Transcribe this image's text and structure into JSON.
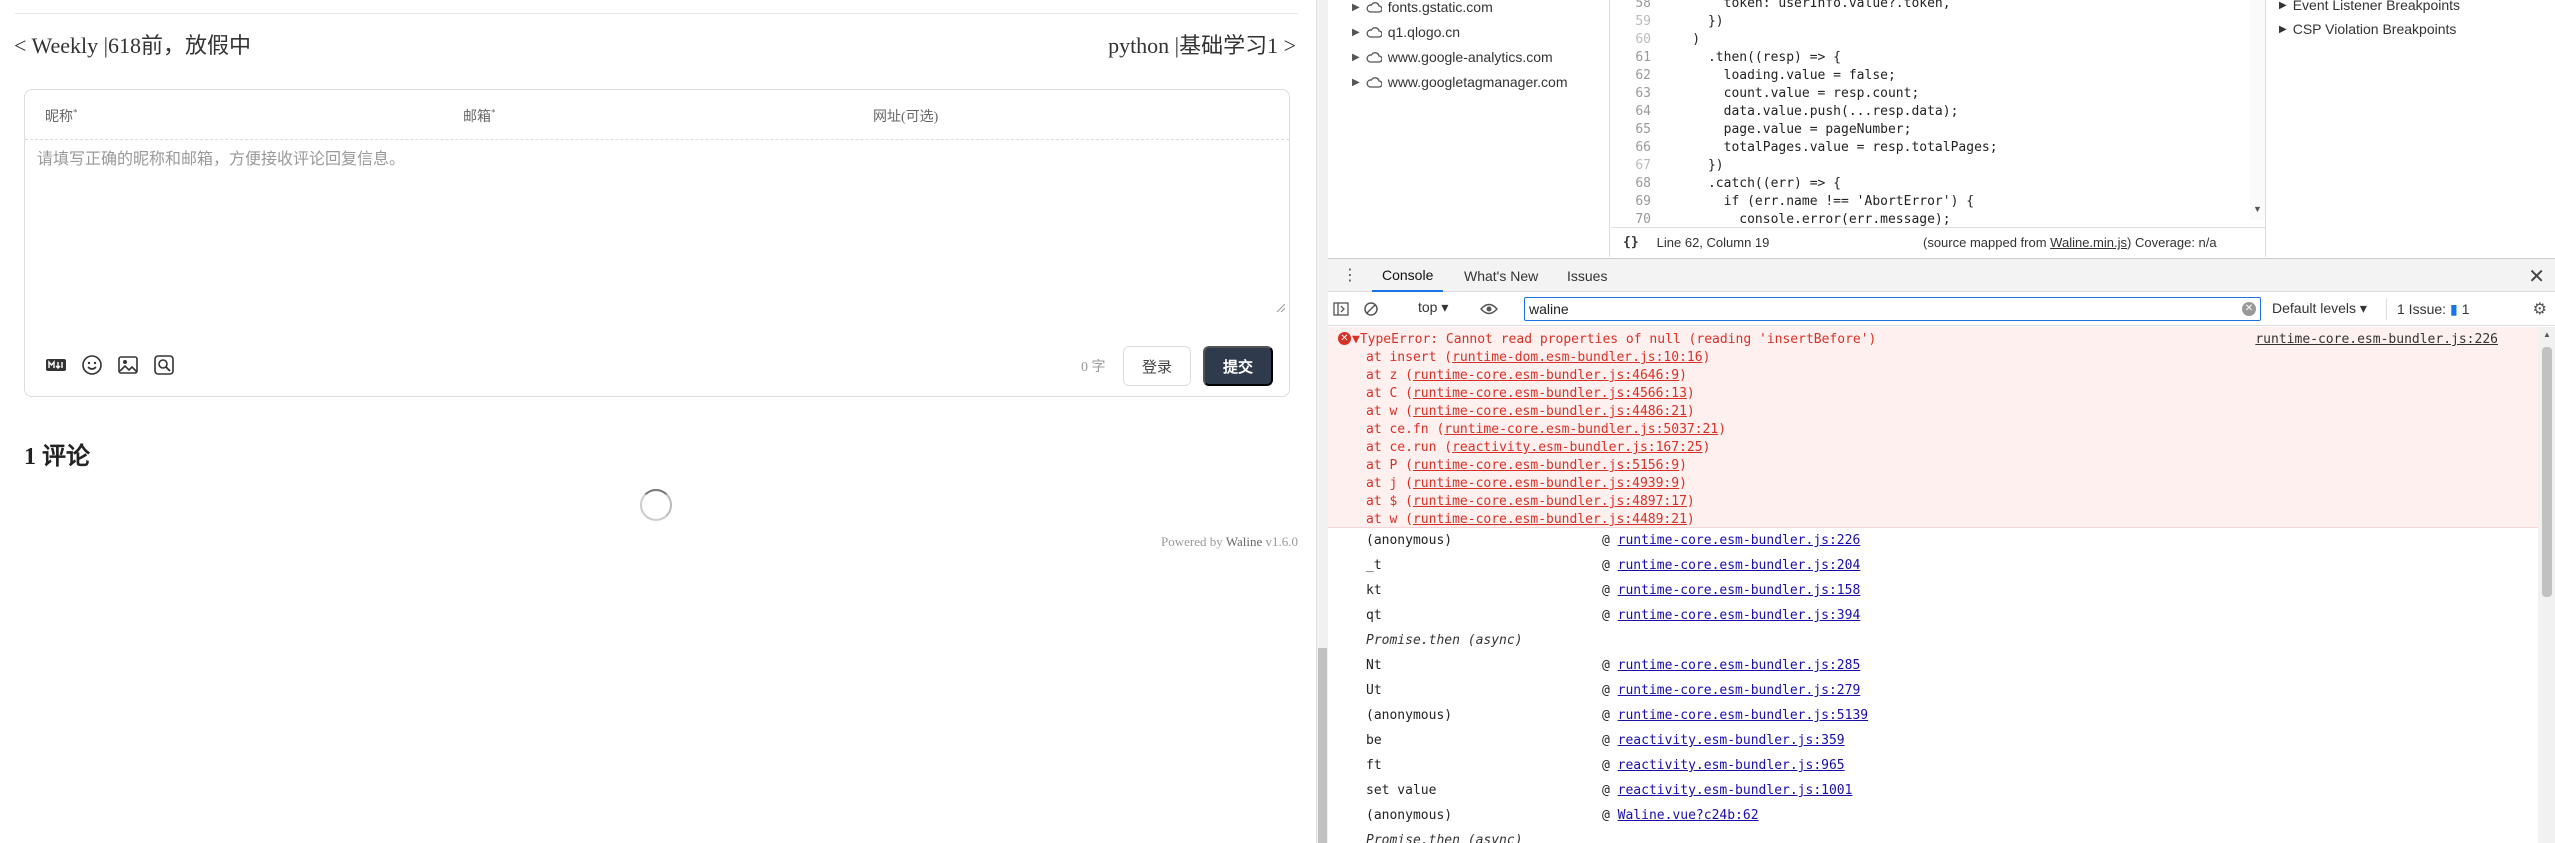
{
  "page": {
    "prev_post": "< Weekly |618前，放假中",
    "next_post": "python |基础学习1 >",
    "comment_form": {
      "nick_label": "昵称",
      "mail_label": "邮箱",
      "link_label": "网址(可选)",
      "required_mark": "*",
      "placeholder": "请填写正确的昵称和邮箱，方便接收评论回复信息。",
      "word_count": "0 字",
      "login_button": "登录",
      "submit_button": "提交"
    },
    "comment_count": "1 评论",
    "powered_prefix": "Powered by",
    "powered_name": "Waline",
    "powered_version": "v1.6.0"
  },
  "devtools": {
    "network_items": [
      "fonts.gstatic.com",
      "q1.qlogo.cn",
      "www.google-analytics.com",
      "www.googletagmanager.com"
    ],
    "code_lines": [
      {
        "n": "58",
        "text": "        token: userInfo.value?.token,",
        "dim": false
      },
      {
        "n": "59",
        "text": "      })",
        "dim": true
      },
      {
        "n": "60",
        "text": "    )",
        "dim": true
      },
      {
        "n": "61",
        "text": "      .then((resp) => {",
        "dim": false
      },
      {
        "n": "62",
        "text": "        loading.value = false;",
        "dim": false
      },
      {
        "n": "63",
        "text": "        count.value = resp.count;",
        "dim": false
      },
      {
        "n": "64",
        "text": "        data.value.push(...resp.data);",
        "dim": false
      },
      {
        "n": "65",
        "text": "        page.value = pageNumber;",
        "dim": false
      },
      {
        "n": "66",
        "text": "        totalPages.value = resp.totalPages;",
        "dim": false
      },
      {
        "n": "67",
        "text": "      })",
        "dim": true
      },
      {
        "n": "68",
        "text": "      .catch((err) => {",
        "dim": false
      },
      {
        "n": "69",
        "text": "        if (err.name !== 'AbortError') {",
        "dim": false
      },
      {
        "n": "70",
        "text": "          console.error(err.message);",
        "dim": false
      }
    ],
    "code_status": {
      "braces": "{}",
      "position": "Line 62, Column 19",
      "source_map_prefix": "(source mapped from ",
      "source_map_file": "Waline.min.js",
      "source_map_suffix": ")",
      "coverage": "Coverage: n/a"
    },
    "breakpoints": [
      "Event Listener Breakpoints",
      "CSP Violation Breakpoints"
    ],
    "drawer_tabs": [
      "Console",
      "What's New",
      "Issues"
    ],
    "console_toolbar": {
      "context": "top",
      "filter_value": "waline",
      "levels": "Default levels",
      "issues_label": "1 Issue:",
      "issues_count": "1"
    },
    "error": {
      "message": "TypeError: Cannot read properties of null (reading 'insertBefore')",
      "source": "runtime-core.esm-bundler.js:226",
      "frames": [
        {
          "fn": "insert",
          "loc": "runtime-dom.esm-bundler.js:10:16"
        },
        {
          "fn": "z",
          "loc": "runtime-core.esm-bundler.js:4646:9"
        },
        {
          "fn": "C",
          "loc": "runtime-core.esm-bundler.js:4566:13"
        },
        {
          "fn": "w",
          "loc": "runtime-core.esm-bundler.js:4486:21"
        },
        {
          "fn": "ce.fn",
          "loc": "runtime-core.esm-bundler.js:5037:21"
        },
        {
          "fn": "ce.run",
          "loc": "reactivity.esm-bundler.js:167:25"
        },
        {
          "fn": "P",
          "loc": "runtime-core.esm-bundler.js:5156:9"
        },
        {
          "fn": "j",
          "loc": "runtime-core.esm-bundler.js:4939:9"
        },
        {
          "fn": "$",
          "loc": "runtime-core.esm-bundler.js:4897:17"
        },
        {
          "fn": "w",
          "loc": "runtime-core.esm-bundler.js:4489:21"
        }
      ]
    },
    "call_stack": [
      {
        "fn": "(anonymous)",
        "loc": "runtime-core.esm-bundler.js:226",
        "async": false
      },
      {
        "fn": "_t",
        "loc": "runtime-core.esm-bundler.js:204",
        "async": false
      },
      {
        "fn": "kt",
        "loc": "runtime-core.esm-bundler.js:158",
        "async": false
      },
      {
        "fn": "qt",
        "loc": "runtime-core.esm-bundler.js:394",
        "async": false
      },
      {
        "fn": "Promise.then (async)",
        "loc": "",
        "async": true
      },
      {
        "fn": "Nt",
        "loc": "runtime-core.esm-bundler.js:285",
        "async": false
      },
      {
        "fn": "Ut",
        "loc": "runtime-core.esm-bundler.js:279",
        "async": false
      },
      {
        "fn": "(anonymous)",
        "loc": "runtime-core.esm-bundler.js:5139",
        "async": false
      },
      {
        "fn": "be",
        "loc": "reactivity.esm-bundler.js:359",
        "async": false
      },
      {
        "fn": "ft",
        "loc": "reactivity.esm-bundler.js:965",
        "async": false
      },
      {
        "fn": "set value",
        "loc": "reactivity.esm-bundler.js:1001",
        "async": false
      },
      {
        "fn": "(anonymous)",
        "loc": "Waline.vue?c24b:62",
        "async": false
      },
      {
        "fn": "Promise.then (async)",
        "loc": "",
        "async": true
      }
    ]
  }
}
